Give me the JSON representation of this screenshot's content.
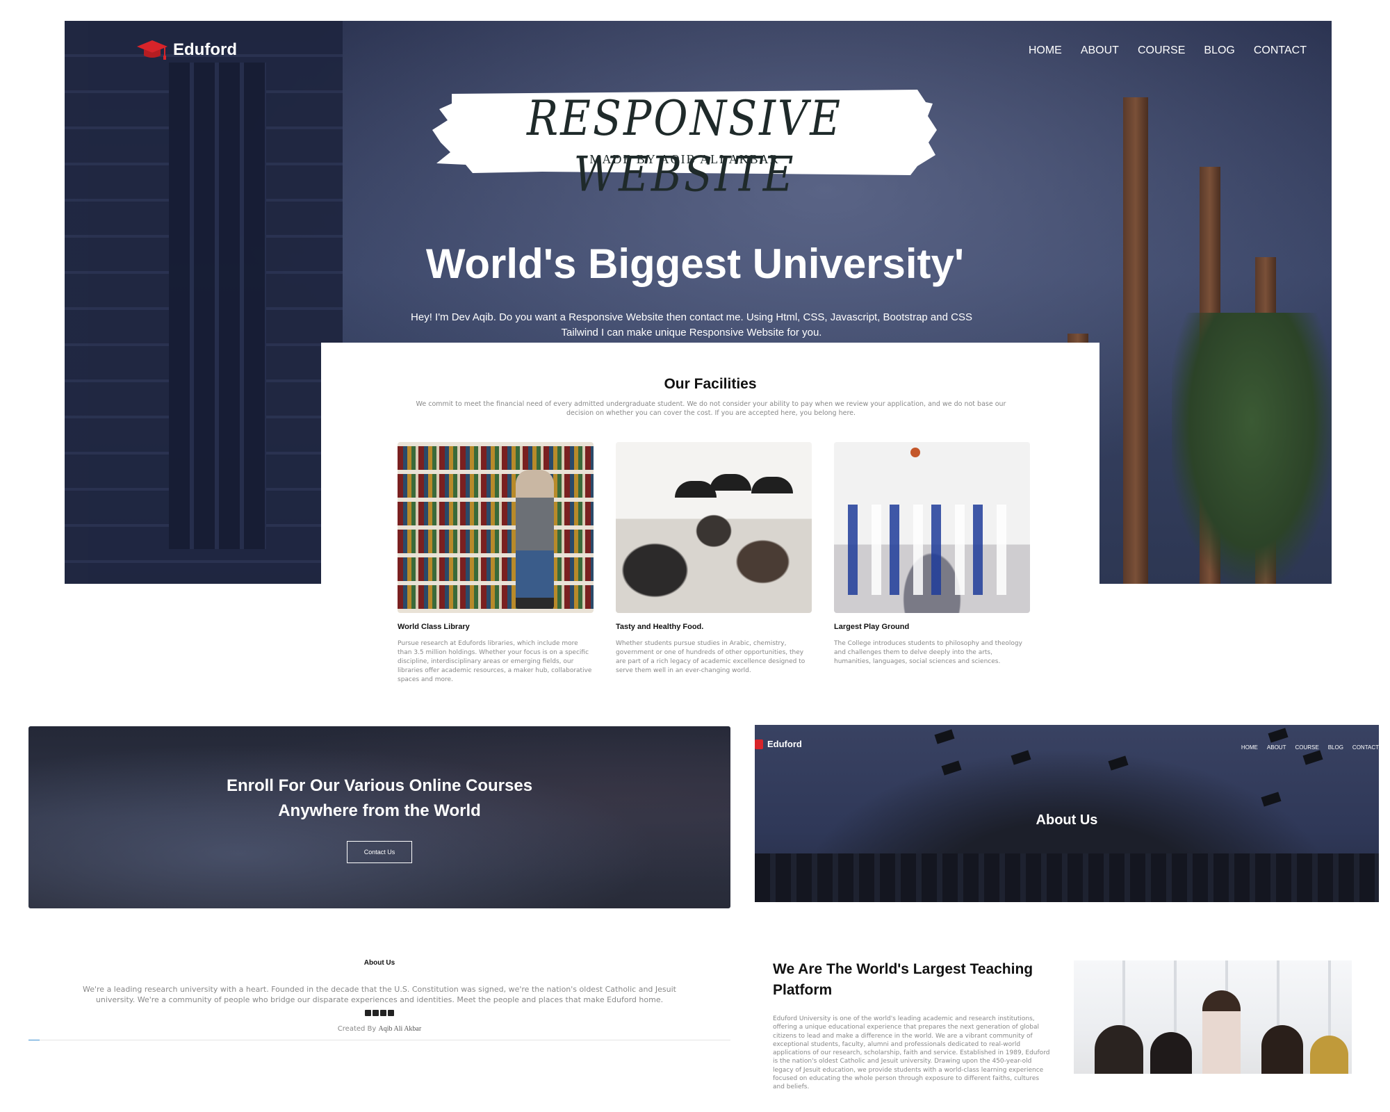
{
  "hero": {
    "logo_text": "Eduford",
    "nav": [
      "HOME",
      "ABOUT",
      "COURSE",
      "BLOG",
      "CONTACT"
    ],
    "banner_title": "RESPONSIVE WEBSITE",
    "banner_subtitle": "MADE BY AQIB ALI AKBAR",
    "heading": "World's Biggest University'",
    "text": "Hey! I'm Dev Aqib. Do you want a Responsive Website then contact me. Using Html, CSS, Javascript, Bootstrap and CSS Tailwind I can make unique Responsive Website for you."
  },
  "facilities": {
    "title": "Our Facilities",
    "description": "We commit to meet the financial need of every admitted undergraduate student. We do not consider your ability to pay when we review your application, and we do not base our decision on whether you can cover the cost. If you are accepted here, you belong here.",
    "cards": [
      {
        "title": "World Class Library",
        "text": "Pursue research at Edufords libraries, which include more than 3.5 million holdings. Whether your focus is on a specific discipline, interdisciplinary areas or emerging fields, our libraries offer academic resources, a maker hub, collaborative spaces and more."
      },
      {
        "title": "Tasty and Healthy Food.",
        "text": "Whether students pursue studies in Arabic, chemistry, government or one of hundreds of other opportunities, they are part of a rich legacy of academic excellence designed to serve them well in an ever-changing world."
      },
      {
        "title": "Largest Play Ground",
        "text": "The College introduces students to philosophy and theology and challenges them to delve deeply into the arts, humanities, languages, social sciences and sciences."
      }
    ]
  },
  "enroll": {
    "title_line1": "Enroll For Our Various Online Courses",
    "title_line2": "Anywhere from the World",
    "button": "Contact Us"
  },
  "about_banner": {
    "logo_text": "Eduford",
    "nav": [
      "HOME",
      "ABOUT",
      "COURSE",
      "BLOG",
      "CONTACT"
    ],
    "title": "About Us"
  },
  "footer": {
    "title": "About Us",
    "text": "We're a leading research university with a heart. Founded in the decade that the U.S. Constitution was signed, we're the nation's oldest Catholic and Jesuit university. We're a community of people who bridge our disparate experiences and identities. Meet the people and places that make Eduford home.",
    "social_icons": [
      "facebook-icon",
      "twitter-icon",
      "instagram-icon",
      "linkedin-icon"
    ],
    "credit_prefix": "Created By",
    "credit_name": "Aqib Ali Akbar"
  },
  "teaching": {
    "title": "We Are The World's Largest Teaching Platform",
    "text": "Eduford University is one of the world's leading academic and research institutions, offering a unique educational experience that prepares the next generation of global citizens to lead and make a difference in the world. We are a vibrant community of exceptional students, faculty, alumni and professionals dedicated to real-world applications of our research, scholarship, faith and service. Established in 1989, Eduford is the nation's oldest Catholic and Jesuit university. Drawing upon the 450-year-old legacy of Jesuit education, we provide students with a world-class learning experience focused on educating the whole person through exposure to different faiths, cultures and beliefs."
  },
  "colors": {
    "brand_red": "#d8242a",
    "hero_overlay": "#2f3858",
    "text_muted": "#888888"
  }
}
